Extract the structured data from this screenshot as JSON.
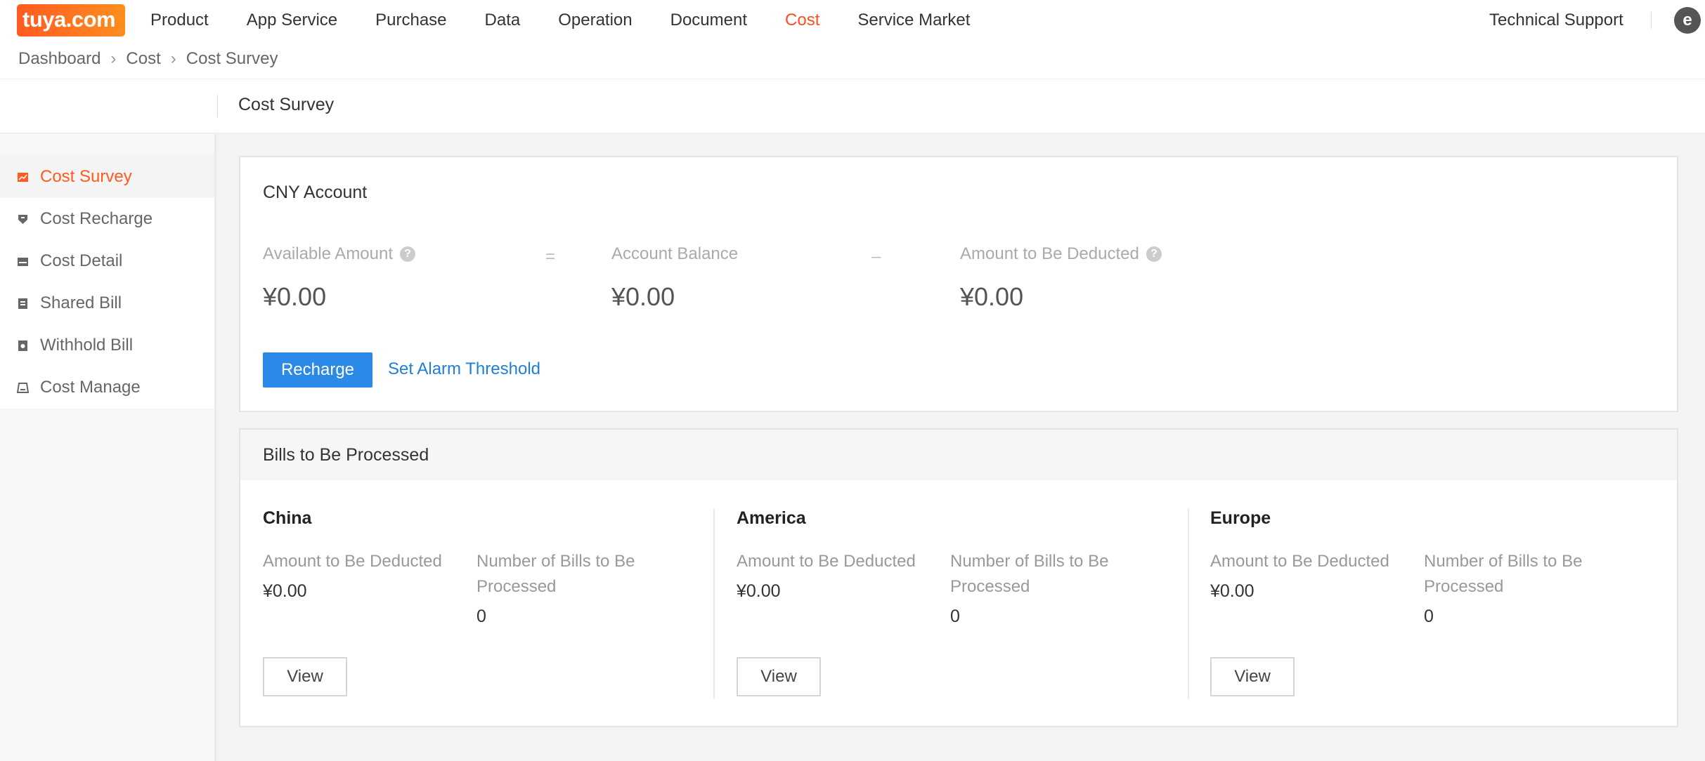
{
  "logo": {
    "text": "tuya.com"
  },
  "nav": {
    "items": [
      "Product",
      "App Service",
      "Purchase",
      "Data",
      "Operation",
      "Document",
      "Cost",
      "Service Market"
    ],
    "active": "Cost",
    "tech_support": "Technical Support"
  },
  "breadcrumb": [
    "Dashboard",
    "Cost",
    "Cost Survey"
  ],
  "page_title": "Cost Survey",
  "sidebar": {
    "items": [
      {
        "label": "Cost Survey",
        "icon": "chart-icon",
        "active": true
      },
      {
        "label": "Cost Recharge",
        "icon": "recharge-icon"
      },
      {
        "label": "Cost Detail",
        "icon": "detail-icon"
      },
      {
        "label": "Shared Bill",
        "icon": "bill-icon"
      },
      {
        "label": "Withhold Bill",
        "icon": "withhold-icon"
      },
      {
        "label": "Cost Manage",
        "icon": "manage-icon"
      }
    ]
  },
  "account": {
    "title": "CNY Account",
    "available_label": "Available Amount",
    "available_value": "¥0.00",
    "equals": "=",
    "balance_label": "Account Balance",
    "balance_value": "¥0.00",
    "minus": "–",
    "deducted_label": "Amount to Be Deducted",
    "deducted_value": "¥0.00",
    "recharge_label": "Recharge",
    "alarm_label": "Set Alarm Threshold"
  },
  "bills": {
    "title": "Bills to Be Processed",
    "regions": [
      {
        "name": "China",
        "deduct_label": "Amount to Be Deducted",
        "deduct_value": "¥0.00",
        "count_label": "Number of Bills to Be Processed",
        "count_value": "0",
        "view_label": "View"
      },
      {
        "name": "America",
        "deduct_label": "Amount to Be Deducted",
        "deduct_value": "¥0.00",
        "count_label": "Number of Bills to Be Processed",
        "count_value": "0",
        "view_label": "View"
      },
      {
        "name": "Europe",
        "deduct_label": "Amount to Be Deducted",
        "deduct_value": "¥0.00",
        "count_label": "Number of Bills to Be Processed",
        "count_value": "0",
        "view_label": "View"
      }
    ]
  },
  "colors": {
    "accent": "#ff4d1f",
    "primary": "#2b8ae8",
    "link": "#1f7fd8"
  }
}
